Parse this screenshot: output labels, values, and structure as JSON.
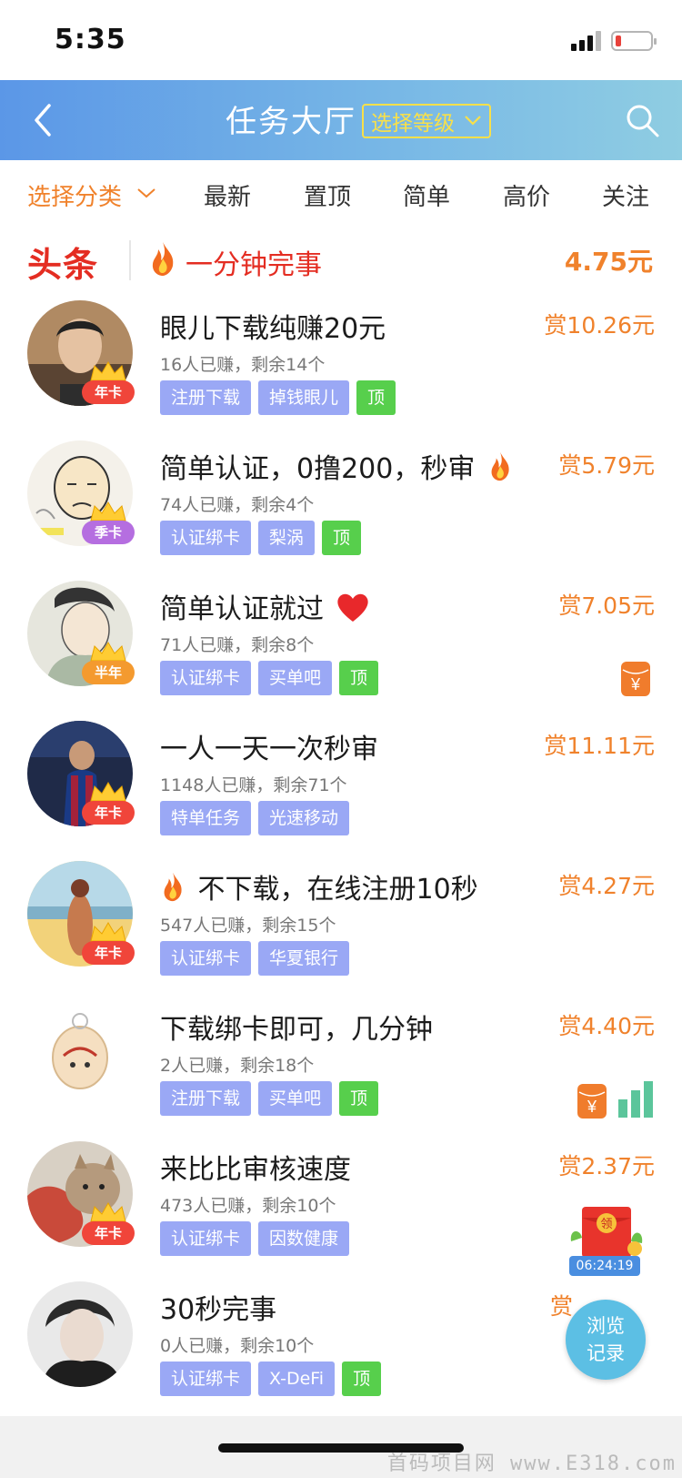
{
  "status_bar": {
    "time": "5:35"
  },
  "header": {
    "title": "任务大厅",
    "level_select": "选择等级"
  },
  "tabs": [
    {
      "label": "选择分类",
      "active": true
    },
    {
      "label": "最新"
    },
    {
      "label": "置顶"
    },
    {
      "label": "简单"
    },
    {
      "label": "高价"
    },
    {
      "label": "关注"
    }
  ],
  "headline": {
    "logo": "头条",
    "text": "一分钟完事",
    "price": "4.75元"
  },
  "tasks": [
    {
      "title": "眼儿下载纯赚20元",
      "meta": "16人已赚，剩余14个",
      "price": "赏10.26元",
      "badge": "年卡",
      "tags": [
        "注册下载",
        "掉钱眼儿"
      ],
      "top_tag": "顶"
    },
    {
      "title": "简单认证，0撸200，秒审",
      "meta": "74人已赚，剩余4个",
      "price": "赏5.79元",
      "badge": "季卡",
      "tags": [
        "认证绑卡",
        "梨涡"
      ],
      "top_tag": "顶"
    },
    {
      "title": "简单认证就过",
      "meta": "71人已赚，剩余8个",
      "price": "赏7.05元",
      "badge": "半年",
      "tags": [
        "认证绑卡",
        "买单吧"
      ],
      "top_tag": "顶"
    },
    {
      "title": "一人一天一次秒审",
      "meta": "1148人已赚，剩余71个",
      "price": "赏11.11元",
      "badge": "年卡",
      "tags": [
        "特单任务",
        "光速移动"
      ],
      "top_tag": ""
    },
    {
      "title": "不下载，在线注册10秒",
      "meta": "547人已赚，剩余15个",
      "price": "赏4.27元",
      "badge": "年卡",
      "tags": [
        "认证绑卡",
        "华夏银行"
      ],
      "top_tag": ""
    },
    {
      "title": "下载绑卡即可，几分钟",
      "meta": "2人已赚，剩余18个",
      "price": "赏4.40元",
      "badge": "",
      "tags": [
        "注册下载",
        "买单吧"
      ],
      "top_tag": "顶"
    },
    {
      "title": "来比比审核速度",
      "meta": "473人已赚，剩余10个",
      "price": "赏2.37元",
      "badge": "年卡",
      "tags": [
        "认证绑卡",
        "因数健康"
      ],
      "top_tag": ""
    },
    {
      "title": "30秒完事",
      "meta": "0人已赚，剩余10个",
      "price": "赏",
      "badge": "",
      "tags": [
        "认证绑卡",
        "X-DeFi"
      ],
      "top_tag": "顶"
    }
  ],
  "side": {
    "yen_glyph": "¥",
    "redpacket_label": "领",
    "redpacket_timer": "06:24:19"
  },
  "float_button": {
    "line1": "浏览",
    "line2": "记录"
  },
  "watermark": "首码项目网 www.E318.com",
  "colors": {
    "accent": "#f0822c",
    "header_gradient_start": "#5b97e7",
    "tag": "#9aa8f5",
    "top_tag": "#57cf4c",
    "headline_red": "#e42d22"
  }
}
